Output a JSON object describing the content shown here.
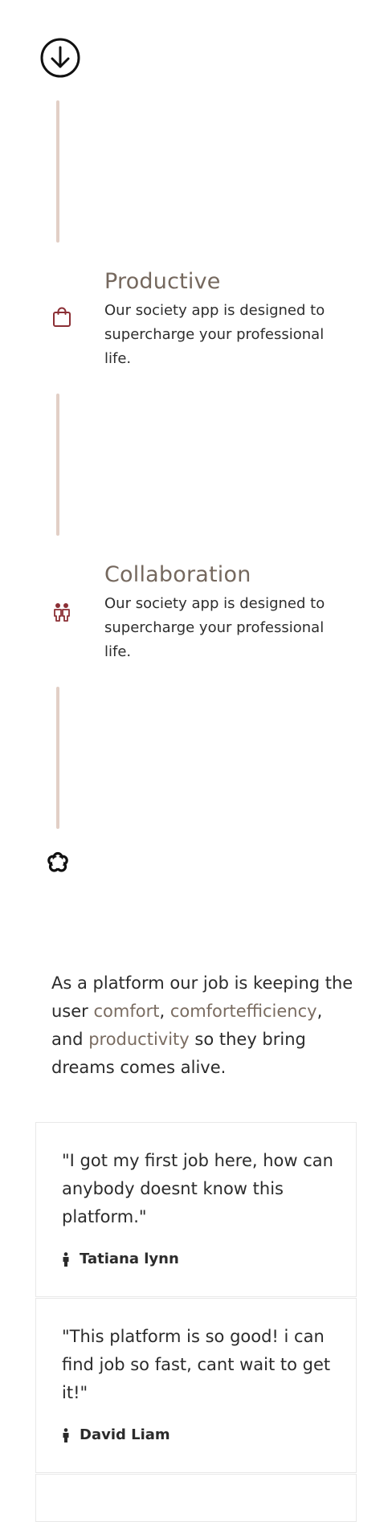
{
  "features": [
    {
      "title": "Productive",
      "description": "Our society app is designed to supercharge your professional life.",
      "icon": "shopping-bag-icon"
    },
    {
      "title": "Collaboration",
      "description": "Our society app is designed to supercharge your professional life.",
      "icon": "people-icon"
    }
  ],
  "mission": {
    "before": "As a platform our job is keeping the user ",
    "hl1": "comfort",
    "mid1": ", ",
    "hl2": "comfortefficiency",
    "mid2": ", and ",
    "hl3": "productivity",
    "after": " so they bring dreams comes alive."
  },
  "testimonials": [
    {
      "quote": "\"I got my first job here, how can anybody doesnt know this platform.\"",
      "author": "Tatiana lynn"
    },
    {
      "quote": "\"This platform is so good! i can find job so fast, cant wait to get it!\"",
      "author": "David Liam"
    }
  ],
  "colors": {
    "accent": "#75685e",
    "icon_red": "#8b2f35",
    "timeline": "#e2cfc6"
  }
}
